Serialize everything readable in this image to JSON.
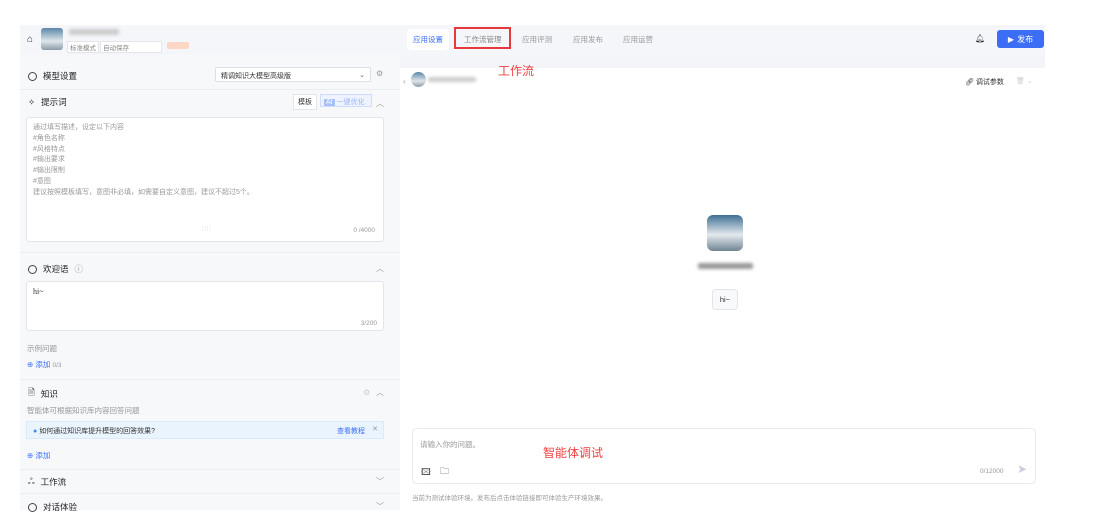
{
  "header": {
    "tags": [
      "标准模式",
      "自动保存"
    ],
    "tabs": [
      "应用设置",
      "工作流管理",
      "应用评测",
      "应用发布",
      "应用运营"
    ],
    "publish": "发布"
  },
  "left": {
    "model": {
      "title": "模型设置",
      "value": "精调知识大模型高级版"
    },
    "prompt": {
      "title": "提示词",
      "template": "模板",
      "optimize": "一键优化",
      "ai": "AI",
      "lines": [
        "通过填写描述，设定以下内容",
        "#角色名称",
        "#风格特点",
        "#输出要求",
        "#输出限制",
        "#意图",
        "建议按照模板填写，意图非必填，如需要自定义意图，建议不超过5个。"
      ],
      "count": "0 /4000"
    },
    "welcome": {
      "title": "欢迎语",
      "value": "hi~",
      "count": "3/200",
      "examples": "示例问题",
      "add": "添加",
      "add_count": "0/3"
    },
    "knowledge": {
      "title": "知识",
      "desc": "智能体可根据知识库内容回答问题",
      "tip": "如何通过知识库提升模型的回答效果?",
      "tip_link": "查看教程",
      "add": "添加"
    },
    "workflow": {
      "title": "工作流"
    },
    "dialog": {
      "title": "对话体验"
    }
  },
  "right": {
    "debug_params": "调试参数",
    "bubble": "hi~",
    "input_placeholder": "请输入你的问题。",
    "input_count": "0/12000",
    "footnote": "当前为测试体验环境。发布后点击体验链接即可体验生产环境效果。"
  },
  "annotations": {
    "workflow": "工作流",
    "debug": "智能体调试"
  },
  "colors": {
    "accent": "#3b6ef5",
    "annotation": "#f04040"
  }
}
